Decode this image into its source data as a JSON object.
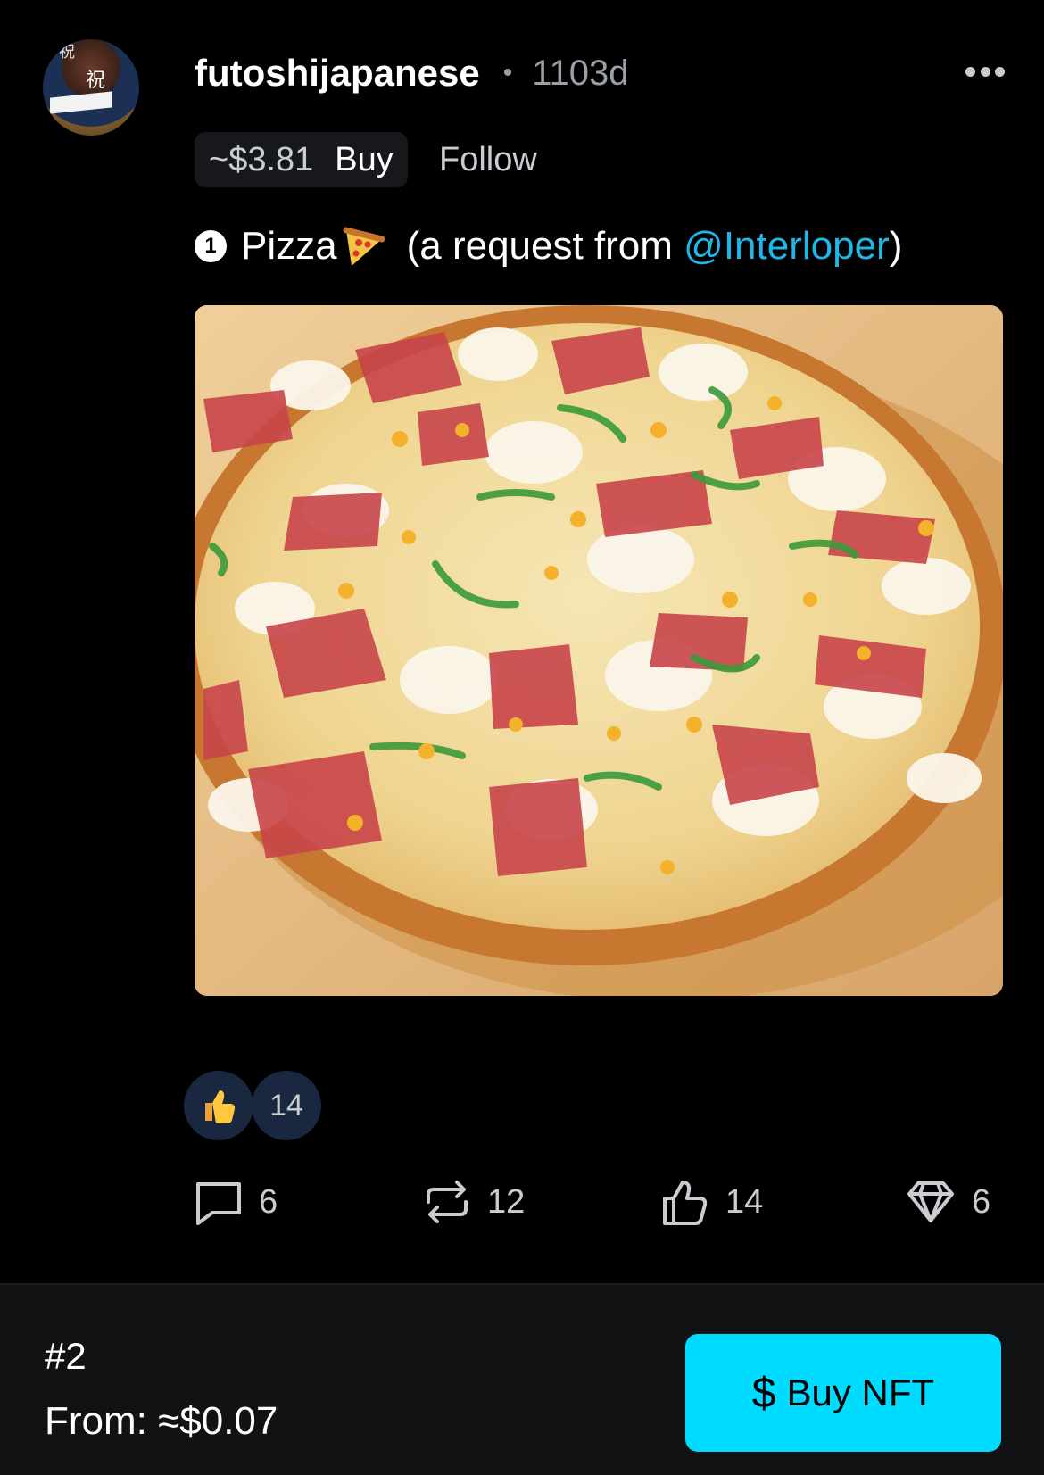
{
  "post": {
    "username": "futoshijapanese",
    "separator": "•",
    "age": "1103d",
    "price": "~$3.81",
    "buy_label": "Buy",
    "follow_label": "Follow",
    "number_badge": "1",
    "text_main": "Pizza",
    "text_request_prefix": "(a request from ",
    "mention": "@Interloper",
    "text_request_suffix": ")"
  },
  "reactions": {
    "count": "14"
  },
  "actions": {
    "comments": "6",
    "reposts": "12",
    "likes": "14",
    "collects": "6"
  },
  "footer": {
    "edition": "#2",
    "from": "From: ≈$0.07",
    "buy_nft_label": "Buy NFT"
  },
  "icons": [
    "more-icon",
    "pizza-emoji-icon",
    "thumbs-up-emoji-icon",
    "comment-icon",
    "repost-icon",
    "like-icon",
    "diamond-icon",
    "dollar-icon"
  ],
  "colors": {
    "background": "#000000",
    "mention": "#1fb6e8",
    "buy_nft_button": "#00dcff",
    "footer_background": "#111214",
    "muted_text": "#9aa0a6"
  }
}
